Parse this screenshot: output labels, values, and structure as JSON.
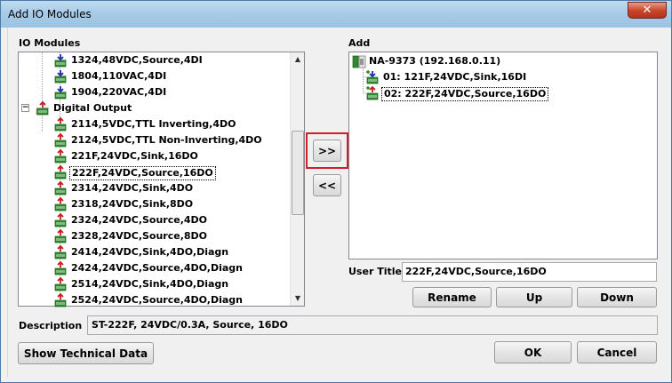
{
  "window": {
    "title": "Add IO Modules",
    "close_glyph": "✕"
  },
  "io_modules": {
    "label": "IO Modules",
    "items": [
      {
        "text": "1324,48VDC,Source,4DI",
        "icon": "digital-input-module-icon",
        "level": 2
      },
      {
        "text": "1804,110VAC,4DI",
        "icon": "digital-input-module-icon",
        "level": 2
      },
      {
        "text": "1904,220VAC,4DI",
        "icon": "digital-input-module-icon",
        "level": 2
      },
      {
        "text": "Digital Output",
        "icon": "digital-output-group-icon",
        "level": 1,
        "expander": "−"
      },
      {
        "text": "2114,5VDC,TTL Inverting,4DO",
        "icon": "digital-output-module-icon",
        "level": 2
      },
      {
        "text": "2124,5VDC,TTL Non-Inverting,4DO",
        "icon": "digital-output-module-icon",
        "level": 2
      },
      {
        "text": "221F,24VDC,Sink,16DO",
        "icon": "digital-output-module-icon",
        "level": 2
      },
      {
        "text": "222F,24VDC,Source,16DO",
        "icon": "digital-output-module-icon",
        "level": 2,
        "selected": true
      },
      {
        "text": "2314,24VDC,Sink,4DO",
        "icon": "digital-output-module-icon",
        "level": 2
      },
      {
        "text": "2318,24VDC,Sink,8DO",
        "icon": "digital-output-module-icon",
        "level": 2
      },
      {
        "text": "2324,24VDC,Source,4DO",
        "icon": "digital-output-module-icon",
        "level": 2
      },
      {
        "text": "2328,24VDC,Source,8DO",
        "icon": "digital-output-module-icon",
        "level": 2
      },
      {
        "text": "2414,24VDC,Sink,4DO,Diagn",
        "icon": "digital-output-module-icon",
        "level": 2
      },
      {
        "text": "2424,24VDC,Source,4DO,Diagn",
        "icon": "digital-output-module-icon",
        "level": 2
      },
      {
        "text": "2514,24VDC,Sink,4DO,Diagn",
        "icon": "digital-output-module-icon",
        "level": 2
      },
      {
        "text": "2524,24VDC,Source,4DO,Diagn",
        "icon": "digital-output-module-icon",
        "level": 2
      }
    ]
  },
  "add_panel": {
    "label": "Add",
    "root": {
      "text": "NA-9373 (192.168.0.11)",
      "icon": "network-adapter-icon"
    },
    "children": [
      {
        "text": "01: 121F,24VDC,Sink,16DI",
        "icon": "digital-input-module-added-icon"
      },
      {
        "text": "02: 222F,24VDC,Source,16DO",
        "icon": "digital-output-module-added-icon",
        "selected": true
      }
    ]
  },
  "transfer": {
    "add_label": ">>",
    "remove_label": "<<"
  },
  "user_title": {
    "label": "User Title",
    "value": "222F,24VDC,Source,16DO"
  },
  "actions": {
    "rename": "Rename",
    "up": "Up",
    "down": "Down"
  },
  "description": {
    "label": "Description",
    "value": "ST-222F, 24VDC/0.3A, Source, 16DO"
  },
  "footer": {
    "show_tech": "Show Technical Data",
    "ok": "OK",
    "cancel": "Cancel"
  },
  "colors": {
    "input_arrow": "#1a2fa8",
    "output_arrow": "#c81e1e",
    "module_green": "#2f8a2f",
    "highlight": "#d21e2b"
  }
}
